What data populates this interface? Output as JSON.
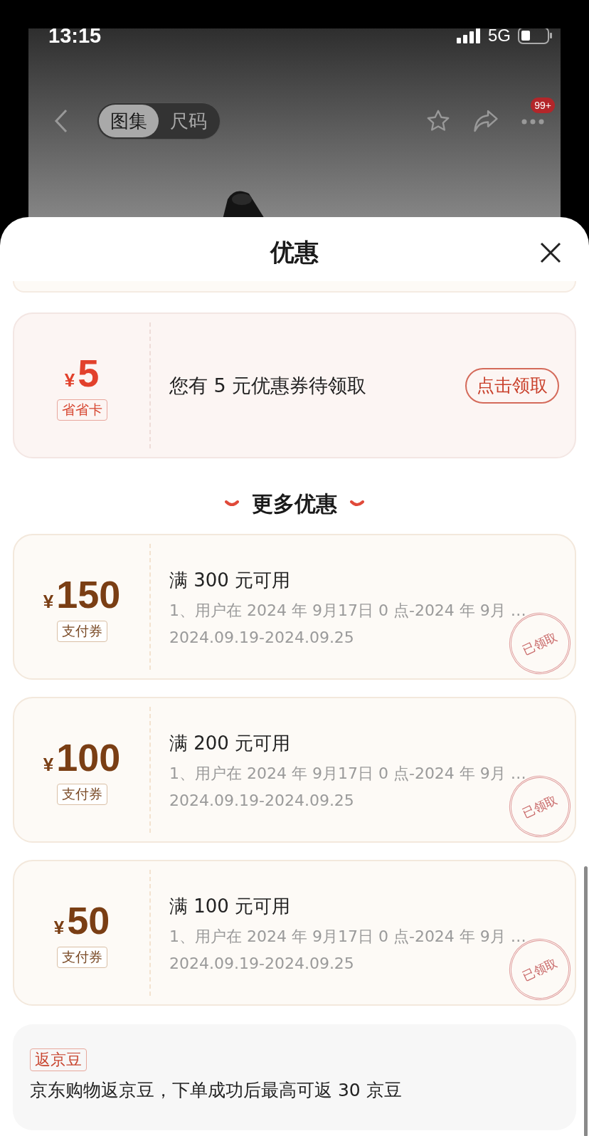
{
  "status_bar": {
    "time": "13:15",
    "network": "5G"
  },
  "nav": {
    "tabs": [
      {
        "label": "图集",
        "selected": true
      },
      {
        "label": "尺码",
        "selected": false
      }
    ],
    "badge": "99+"
  },
  "sheet": {
    "title": "优惠"
  },
  "card": {
    "currency": "¥",
    "amount": "5",
    "tag": "省省卡",
    "text": "您有 5 元优惠券待领取",
    "button": "点击领取"
  },
  "more": {
    "title": "更多优惠"
  },
  "coupons": [
    {
      "currency": "¥",
      "amount": "150",
      "tag": "支付券",
      "title": "满 300 元可用",
      "desc": "1、用户在 2024 年 9月17日 0 点-2024 年 9月 …",
      "dates": "2024.09.19-2024.09.25",
      "claimed": true,
      "stamp": "已领取"
    },
    {
      "currency": "¥",
      "amount": "100",
      "tag": "支付券",
      "title": "满 200 元可用",
      "desc": "1、用户在 2024 年 9月17日 0 点-2024 年 9月 …",
      "dates": "2024.09.19-2024.09.25",
      "claimed": true,
      "stamp": "已领取"
    },
    {
      "currency": "¥",
      "amount": "50",
      "tag": "支付券",
      "title": "满 100 元可用",
      "desc": "1、用户在 2024 年 9月17日 0 点-2024 年 9月 …",
      "dates": "2024.09.19-2024.09.25",
      "claimed": true,
      "stamp": "已领取"
    }
  ],
  "rebate": {
    "tag": "返京豆",
    "text": "京东购物返京豆，下单成功后最高可返 30 京豆"
  }
}
